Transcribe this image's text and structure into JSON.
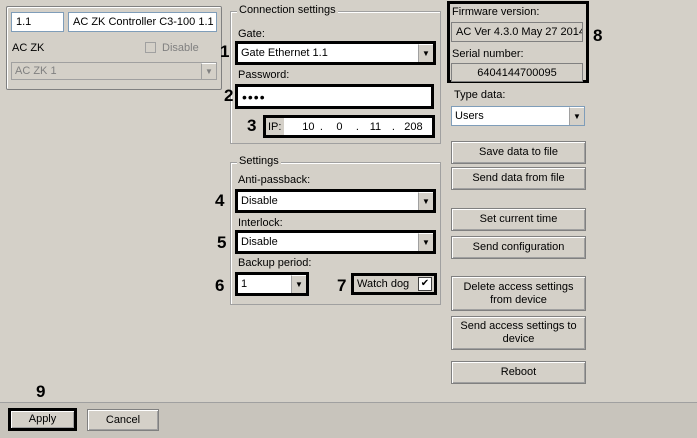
{
  "device": {
    "id": "1.1",
    "name": "AC ZK Controller C3-100 1.1",
    "type_label": "AC ZK",
    "disable_label": "Disable",
    "parent_value": "AC ZK 1"
  },
  "connection": {
    "title": "Connection settings",
    "gate_label": "Gate:",
    "gate_value": "Gate Ethernet 1.1",
    "password_label": "Password:",
    "password_value": "••••",
    "ip_label": "IP:",
    "ip": [
      "10",
      "0",
      "11",
      "208"
    ]
  },
  "settings": {
    "title": "Settings",
    "antipassback_label": "Anti-passback:",
    "antipassback_value": "Disable",
    "interlock_label": "Interlock:",
    "interlock_value": "Disable",
    "backup_label": "Backup period:",
    "backup_value": "1",
    "watchdog_label": "Watch dog",
    "watchdog_checked": true
  },
  "firmware": {
    "version_label": "Firmware version:",
    "version_value": "AC Ver 4.3.0 May 27 2014",
    "serial_label": "Serial number:",
    "serial_value": "6404144700095"
  },
  "typedata": {
    "label": "Type data:",
    "value": "Users"
  },
  "buttons": {
    "save_data": "Save data to file",
    "send_data": "Send data from file",
    "set_time": "Set current time",
    "send_config": "Send configuration",
    "delete_access": "Delete access settings from device",
    "send_access": "Send  access settings to device",
    "reboot": "Reboot",
    "apply": "Apply",
    "cancel": "Cancel"
  },
  "markers": [
    "1",
    "2",
    "3",
    "4",
    "5",
    "6",
    "7",
    "8",
    "9"
  ],
  "icons": {
    "combo_arrow": "chevron-down-icon",
    "check": "check-icon"
  }
}
